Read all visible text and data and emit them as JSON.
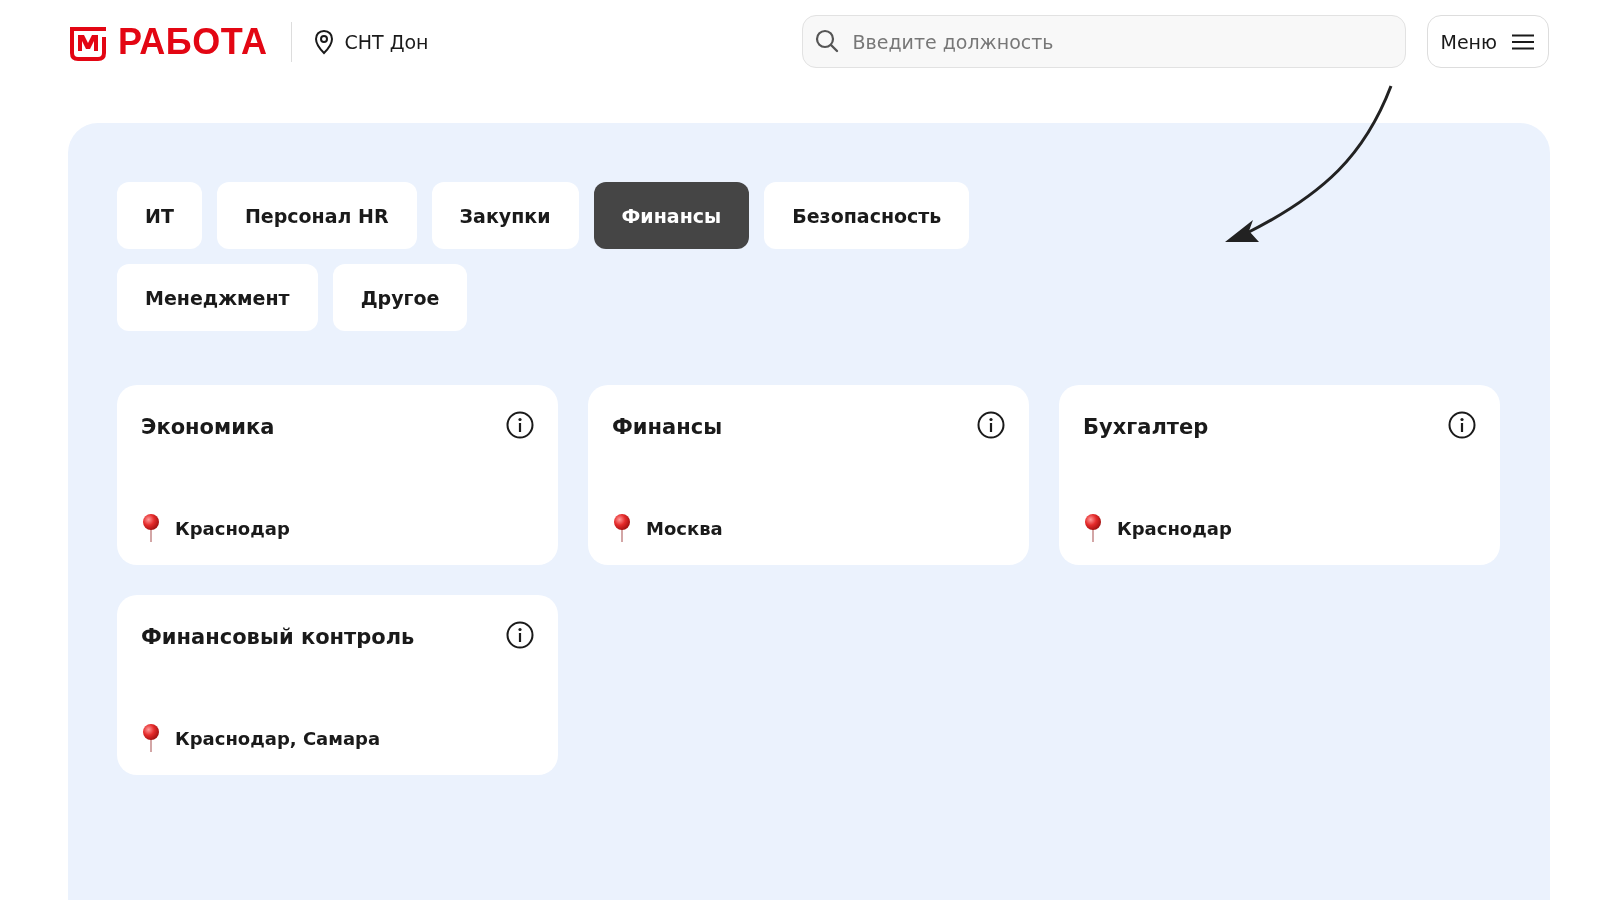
{
  "header": {
    "logo_text": "РАБОТА",
    "location": "СНТ Дон",
    "search": {
      "placeholder": "Введите должность"
    },
    "menu_button": "Меню"
  },
  "tabs": [
    {
      "label": "ИТ",
      "selected": false
    },
    {
      "label": "Персонал HR",
      "selected": false
    },
    {
      "label": "Закупки",
      "selected": false
    },
    {
      "label": "Финансы",
      "selected": true
    },
    {
      "label": "Безопасность",
      "selected": false
    },
    {
      "label": "Менеджмент",
      "selected": false
    },
    {
      "label": "Другое",
      "selected": false
    }
  ],
  "vacancies": [
    {
      "title": "Экономика",
      "location": "Краснодар"
    },
    {
      "title": "Финансы",
      "location": "Москва"
    },
    {
      "title": "Бухгалтер",
      "location": "Краснодар"
    },
    {
      "title": "Финансовый контроль",
      "location": "Краснодар, Самара"
    }
  ]
}
